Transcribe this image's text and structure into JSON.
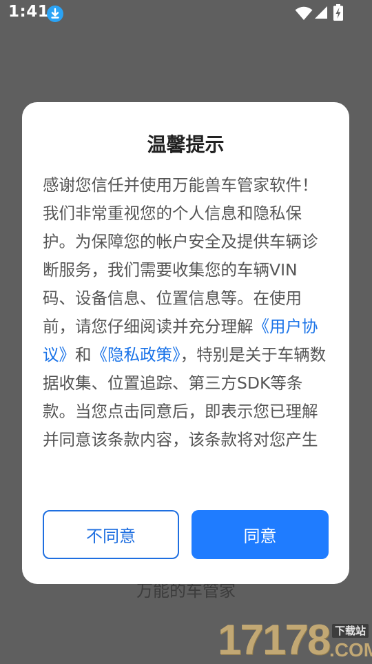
{
  "status_bar": {
    "time": "1:41"
  },
  "icons": {
    "download": "download-icon",
    "wifi": "wifi-icon",
    "signal": "signal-icon",
    "battery": "battery-charging-icon"
  },
  "background": {
    "caption": "万能的车管家"
  },
  "watermark": {
    "digits": "17178",
    "domain": ".COM",
    "tag": "下载站"
  },
  "dialog": {
    "title": "温馨提示",
    "body": {
      "intro": "感谢您信任并使用万能兽车管家软件！我们非常重视您的个人信息和隐私保护。为保障您的帐户安全及提供车辆诊断服务，我们需要收集您的车辆VIN码、设备信息、位置信息等。在使用前，请您仔细阅读并充分理解",
      "user_agreement_link": "《用户协议》",
      "and": "和",
      "privacy_policy_link": "《隐私政策》",
      "rest": "，特别是关于车辆数据收集、位置追踪、第三方SDK等条款。当您点击同意后，即表示您已理解并同意该条款内容，该条款将对您产生"
    },
    "disagree_label": "不同意",
    "agree_label": "同意"
  },
  "colors": {
    "accent": "#1f7cff",
    "link": "#1a73e8",
    "overlay": "#5f5f5f"
  }
}
